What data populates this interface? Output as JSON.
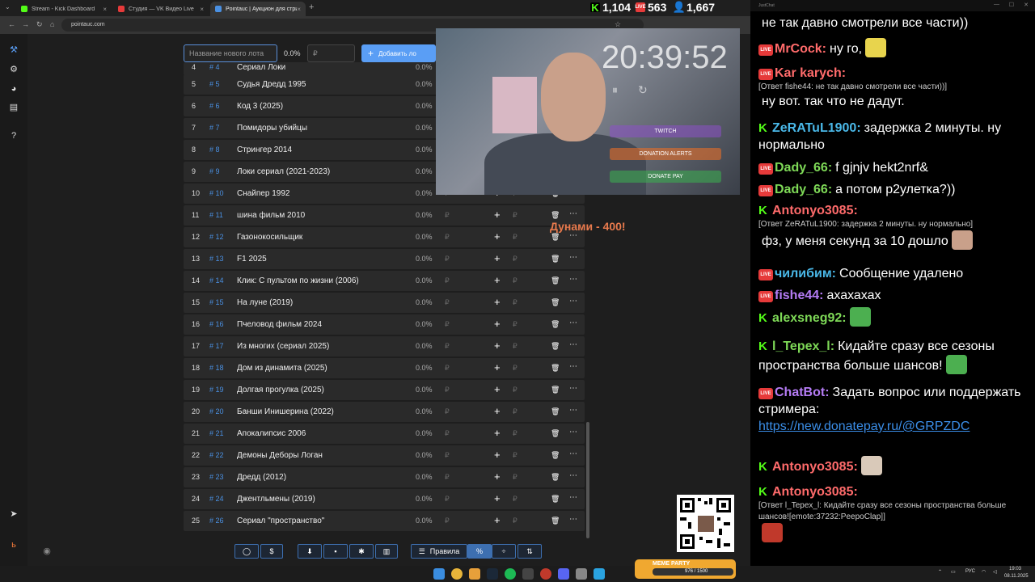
{
  "browser": {
    "tabs": [
      {
        "label": "Stream - Kick Dashboard",
        "active": false,
        "color": "#53fc18"
      },
      {
        "label": "Студия — VK Видео Live",
        "active": false,
        "color": "#e63a3a"
      },
      {
        "label": "Pointauc | Аукцион для стриме",
        "active": true,
        "color": "#4a90e2"
      }
    ],
    "url": "pointauc.com"
  },
  "stats": {
    "kick_viewers": "1,104",
    "vk_viewers": "563",
    "total_viewers": "1,667"
  },
  "auction": {
    "lot_placeholder": "Название нового лота",
    "percent_header": "0.0%",
    "amount_placeholder": "₽",
    "add_button": "Добавить ло",
    "rows": [
      {
        "idx": "4",
        "hash": "# 4",
        "name": "Сериал Локи",
        "pct": "0.0%"
      },
      {
        "idx": "5",
        "hash": "# 5",
        "name": "Судья Дредд 1995",
        "pct": "0.0%"
      },
      {
        "idx": "6",
        "hash": "# 6",
        "name": "Код 3 (2025)",
        "pct": "0.0%"
      },
      {
        "idx": "7",
        "hash": "# 7",
        "name": "Помидоры убийцы",
        "pct": "0.0%"
      },
      {
        "idx": "8",
        "hash": "# 8",
        "name": "Стрингер 2014",
        "pct": "0.0%"
      },
      {
        "idx": "9",
        "hash": "# 9",
        "name": "Локи сериал (2021-2023)",
        "pct": "0.0%"
      },
      {
        "idx": "10",
        "hash": "# 10",
        "name": "Снайпер 1992",
        "pct": "0.0%"
      },
      {
        "idx": "11",
        "hash": "# 11",
        "name": "шина фильм 2010",
        "pct": "0.0%"
      },
      {
        "idx": "12",
        "hash": "# 12",
        "name": "Газонокосильщик",
        "pct": "0.0%"
      },
      {
        "idx": "13",
        "hash": "# 13",
        "name": "F1 2025",
        "pct": "0.0%"
      },
      {
        "idx": "14",
        "hash": "# 14",
        "name": "Клик: С пультом по жизни (2006)",
        "pct": "0.0%"
      },
      {
        "idx": "15",
        "hash": "# 15",
        "name": "На луне (2019)",
        "pct": "0.0%"
      },
      {
        "idx": "16",
        "hash": "# 16",
        "name": "Пчеловод фильм 2024",
        "pct": "0.0%"
      },
      {
        "idx": "17",
        "hash": "# 17",
        "name": "Из многих (сериал 2025)",
        "pct": "0.0%"
      },
      {
        "idx": "18",
        "hash": "# 18",
        "name": "Дом из динамита (2025)",
        "pct": "0.0%"
      },
      {
        "idx": "19",
        "hash": "# 19",
        "name": "Долгая прогулка (2025)",
        "pct": "0.0%"
      },
      {
        "idx": "20",
        "hash": "# 20",
        "name": "Банши Инишерина (2022)",
        "pct": "0.0%"
      },
      {
        "idx": "21",
        "hash": "# 21",
        "name": "Апокалипсис 2006",
        "pct": "0.0%"
      },
      {
        "idx": "22",
        "hash": "# 22",
        "name": "Демоны Деборы Логан",
        "pct": "0.0%"
      },
      {
        "idx": "23",
        "hash": "# 23",
        "name": "Дредд (2012)",
        "pct": "0.0%"
      },
      {
        "idx": "24",
        "hash": "# 24",
        "name": "Джентльмены (2019)",
        "pct": "0.0%"
      },
      {
        "idx": "25",
        "hash": "# 26",
        "name": "Сериал \"пространство\"",
        "pct": "0.0%"
      }
    ],
    "currency": "₽",
    "toolbar": {
      "rules": "Правила",
      "percent": "%"
    }
  },
  "overlay": {
    "clock": "20:39:52",
    "buttons": [
      "TWITCH",
      "DONATION ALERTS",
      "DONATE PAY"
    ],
    "donation_text": "Дунами - 400!"
  },
  "chat": {
    "title": "JustChat",
    "messages": [
      {
        "badge": "",
        "user": "",
        "user_color": "#ffffff",
        "text": "не так давно смотрели все части))"
      },
      {
        "badge": "vk",
        "user": "MrCock:",
        "user_color": "#ff6b6b",
        "text": "ну го,",
        "emote": "#e8d44d"
      },
      {
        "badge": "vk",
        "user": "Kar karych:",
        "user_color": "#ff6b6b",
        "reply": "[Ответ fishe44: не так давно смотрели все части))]",
        "text": "ну вот. так что не дадут."
      },
      {
        "badge": "kick",
        "user": "ZeRATuL1900:",
        "user_color": "#4ab8e8",
        "text": "задержка 2 минуты. ну нормально"
      },
      {
        "badge": "vk",
        "user": "Dady_66:",
        "user_color": "#7ed957",
        "text": "f gjnjv hekt2nrf&"
      },
      {
        "badge": "vk",
        "user": "Dady_66:",
        "user_color": "#7ed957",
        "text": "а потом р2улетка?))"
      },
      {
        "badge": "kick",
        "user": "Antonyo3085:",
        "user_color": "#ff6b6b",
        "reply": "[Ответ ZeRATuL1900: задержка 2 минуты. ну нормально]",
        "text": "фз, у меня секунд за 10 дошло",
        "emote": "#c9a08a"
      },
      {
        "badge": "vk",
        "user": "чилибим:",
        "user_color": "#4ab8e8",
        "text": "Сообщение удалено"
      },
      {
        "badge": "vk",
        "user": "fishe44:",
        "user_color": "#b57cf5",
        "text": "ахахахах"
      },
      {
        "badge": "kick",
        "user": "alexsneg92:",
        "user_color": "#7ed957",
        "text": "",
        "emote": "#4caf50"
      },
      {
        "badge": "kick",
        "user": "l_Tepex_l:",
        "user_color": "#7ed957",
        "text": "Кидайте сразу все сезоны пространства больше шансов!",
        "emote": "#4caf50"
      },
      {
        "badge": "vk",
        "user": "ChatBot:",
        "user_color": "#b57cf5",
        "text": "Задать вопрос или поддержать стримера:",
        "link": "https://new.donatepay.ru/@GRPZDC"
      },
      {
        "badge": "kick",
        "user": "Antonyo3085:",
        "user_color": "#ff6b6b",
        "text": "",
        "emote": "#d9c9b9"
      },
      {
        "badge": "kick",
        "user": "Antonyo3085:",
        "user_color": "#ff6b6b",
        "reply": "[Ответ l_Tepex_l: Кидайте сразу все сезоны пространства больше шансов![emote:37232:PeepoClap]]",
        "text": "",
        "emote": "#c0392b"
      }
    ]
  },
  "taskbar": {
    "lang": "РУС",
    "time": "19:03",
    "date": "08.11.2025",
    "party_label": "MEME PARTY",
    "party_count": "976 / 1500"
  }
}
